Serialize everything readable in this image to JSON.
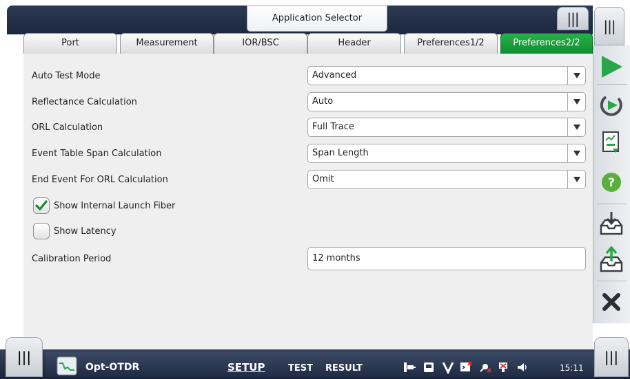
{
  "window": {
    "app_selector_label": "Application Selector"
  },
  "tabs": [
    {
      "label": "Port",
      "active": false
    },
    {
      "label": "Measurement",
      "active": false
    },
    {
      "label": "IOR/BSC",
      "active": false
    },
    {
      "label": "Header",
      "active": false
    },
    {
      "label": "Preferences1/2",
      "active": false
    },
    {
      "label": "Preferences2/2",
      "active": true
    }
  ],
  "settings": {
    "auto_test_mode": {
      "label": "Auto Test Mode",
      "value": "Advanced"
    },
    "reflectance_calculation": {
      "label": "Reflectance Calculation",
      "value": "Auto"
    },
    "orl_calculation": {
      "label": "ORL Calculation",
      "value": "Full Trace"
    },
    "event_table_span": {
      "label": "Event Table Span Calculation",
      "value": "Span Length"
    },
    "end_event_orl": {
      "label": "End Event For ORL Calculation",
      "value": "Omit"
    },
    "show_internal_launch_fiber": {
      "label": "Show Internal Launch Fiber",
      "checked": true
    },
    "show_latency": {
      "label": "Show Latency",
      "checked": false
    },
    "calibration_period": {
      "label": "Calibration Period",
      "value": "12 months"
    }
  },
  "right_toolbar": {
    "icons": [
      "play-icon",
      "repeat-play-icon",
      "report-icon",
      "help-icon",
      "save-icon",
      "upload-icon",
      "close-icon"
    ]
  },
  "bottom_bar": {
    "app_name": "Opt-OTDR",
    "nav": [
      {
        "label": "SETUP",
        "active": true
      },
      {
        "label": "TEST",
        "active": false
      },
      {
        "label": "RESULT",
        "active": false
      }
    ],
    "clock": "15:11"
  },
  "colors": {
    "accent_green": "#1aa03c",
    "dark_bar": "#1c2740",
    "help_green": "#55b33a",
    "close_dark": "#2b2f36"
  }
}
